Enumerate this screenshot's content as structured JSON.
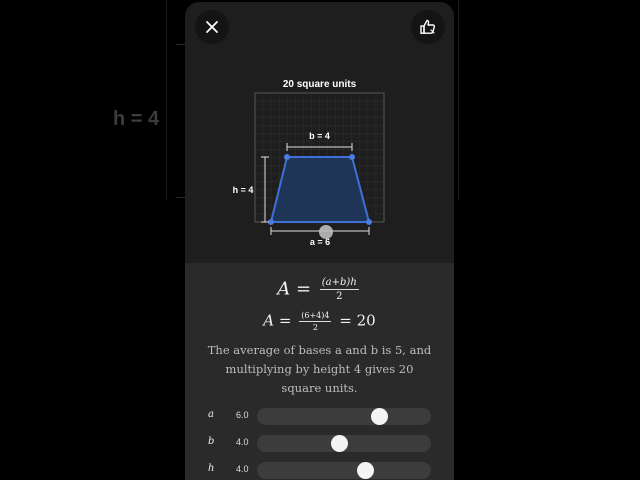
{
  "background": {
    "label": "h = 4"
  },
  "header": {
    "close_icon": "close-icon",
    "like_icon": "thumbs-up-icon"
  },
  "chart": {
    "title": "20 square units",
    "base_top_label": "b = 4",
    "height_label": "h = 4",
    "base_bottom_label": "a = 6",
    "colors": {
      "outline": "#3f6fd8",
      "fill": "#1e3558",
      "grid": "#2e2e2e"
    }
  },
  "formula": {
    "lhs": "A",
    "eq": "=",
    "num": "(a+b)h",
    "den": "2",
    "sub_lhs": "A",
    "sub_num": "(6+4)4",
    "sub_den": "2",
    "sub_result": "= 20"
  },
  "explanation": "The average of bases a and b is 5, and multiplying by height 4 gives 20 square units.",
  "sliders": [
    {
      "var": "a",
      "value": "6.0",
      "fraction": 0.7
    },
    {
      "var": "b",
      "value": "4.0",
      "fraction": 0.47
    },
    {
      "var": "h",
      "value": "4.0",
      "fraction": 0.62
    }
  ]
}
